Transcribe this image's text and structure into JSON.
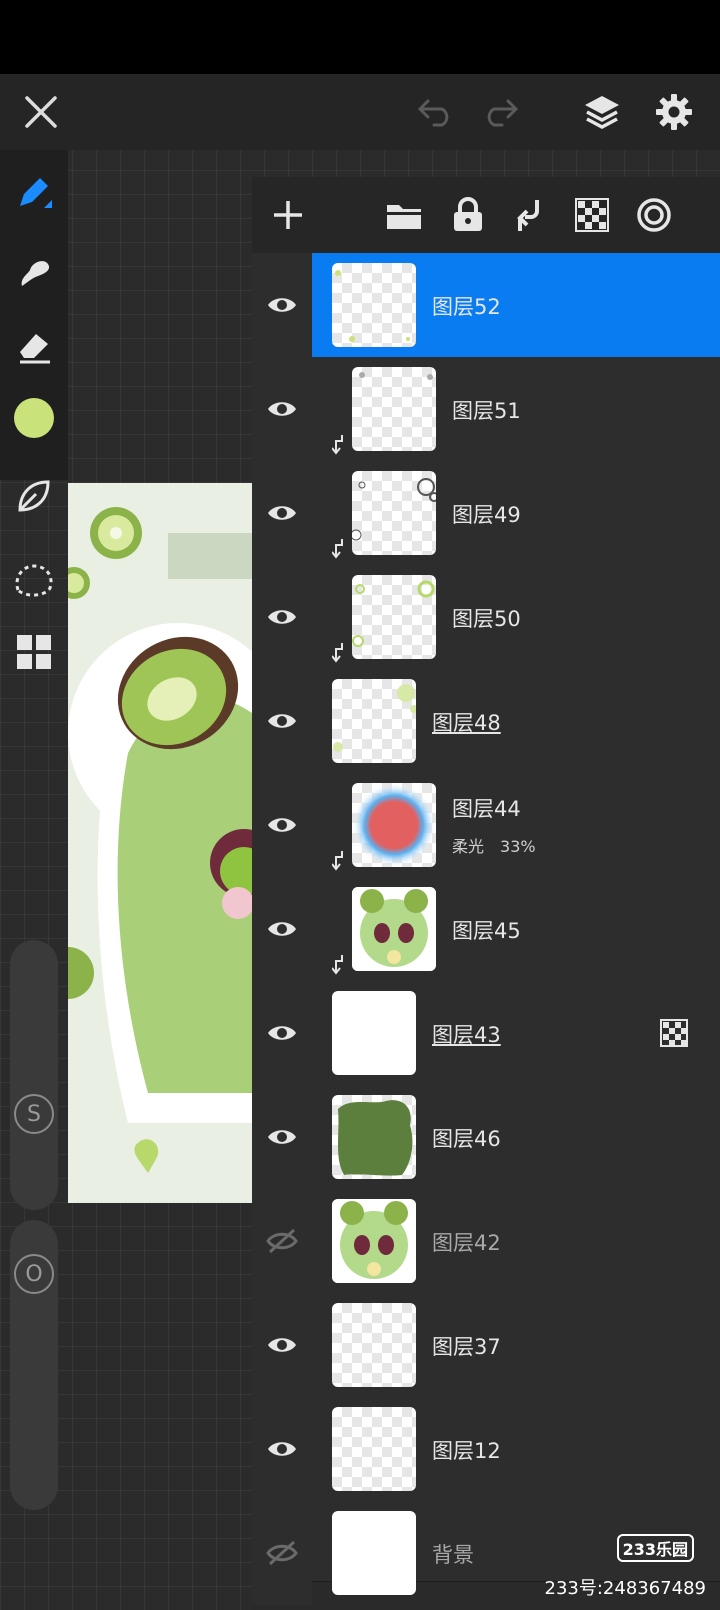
{
  "layers_panel": {
    "layers": [
      {
        "name": "图层52",
        "visible": true,
        "selected": true,
        "clipped": false,
        "underlined": false
      },
      {
        "name": "图层51",
        "visible": true,
        "selected": false,
        "clipped": true,
        "underlined": false
      },
      {
        "name": "图层49",
        "visible": true,
        "selected": false,
        "clipped": true,
        "underlined": false
      },
      {
        "name": "图层50",
        "visible": true,
        "selected": false,
        "clipped": true,
        "underlined": false
      },
      {
        "name": "图层48",
        "visible": true,
        "selected": false,
        "clipped": false,
        "underlined": true
      },
      {
        "name": "图层44",
        "visible": true,
        "selected": false,
        "clipped": true,
        "underlined": false,
        "blend_mode": "柔光",
        "opacity": "33%"
      },
      {
        "name": "图层45",
        "visible": true,
        "selected": false,
        "clipped": true,
        "underlined": false
      },
      {
        "name": "图层43",
        "visible": true,
        "selected": false,
        "clipped": false,
        "underlined": true,
        "alpha_lock_icon": "checker-icon"
      },
      {
        "name": "图层46",
        "visible": true,
        "selected": false,
        "clipped": false,
        "underlined": false
      },
      {
        "name": "图层42",
        "visible": false,
        "selected": false,
        "clipped": false,
        "underlined": false
      },
      {
        "name": "图层37",
        "visible": true,
        "selected": false,
        "clipped": false,
        "underlined": false
      },
      {
        "name": "图层12",
        "visible": true,
        "selected": false,
        "clipped": false,
        "underlined": false
      },
      {
        "name": "背景",
        "visible": false,
        "selected": false,
        "clipped": false,
        "underlined": false
      }
    ]
  },
  "sliders": {
    "size_label": "S",
    "opacity_label": "O"
  },
  "watermark": {
    "logo": "233乐园",
    "id_text": "233号:248367489"
  },
  "colors": {
    "accent": "#0a7cf2",
    "current_color": "#c9e27a",
    "panel_bg": "#2d2d2d"
  }
}
